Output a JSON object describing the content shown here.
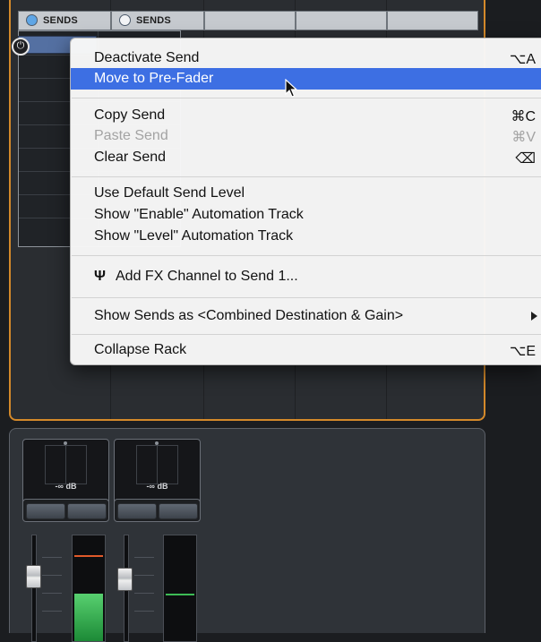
{
  "sends_headers": [
    {
      "label": "SENDS",
      "active": true
    },
    {
      "label": "SENDS",
      "active": false
    }
  ],
  "colors": {
    "rack_border": "#d4892a",
    "menu_highlight": "#3d6fe3",
    "send_active_slot": "#5470a2",
    "meter_green": "#2eaa4a",
    "meter_peak": "#e05a2a"
  },
  "context_menu": {
    "deactivate": {
      "label": "Deactivate Send",
      "shortcut": "⌥A"
    },
    "move_pre": {
      "label": "Move to Pre-Fader"
    },
    "copy": {
      "label": "Copy Send",
      "shortcut": "⌘C"
    },
    "paste": {
      "label": "Paste Send",
      "shortcut": "⌘V",
      "disabled": true
    },
    "clear": {
      "label": "Clear Send",
      "shortcut": "⌫"
    },
    "default_level": {
      "label": "Use Default Send Level"
    },
    "enable_auto": {
      "label": "Show \"Enable\" Automation Track"
    },
    "level_auto": {
      "label": "Show \"Level\" Automation Track"
    },
    "add_fx": {
      "label": "Add FX Channel to Send 1...",
      "icon": "fx-channel-icon"
    },
    "show_as": {
      "label": "Show Sends as <Combined Destination & Gain>",
      "has_submenu": true
    },
    "collapse": {
      "label": "Collapse Rack",
      "shortcut": "⌥E"
    }
  },
  "channels": [
    {
      "db": "-∞ dB",
      "fader_level": 0.62,
      "meter_level": 0.45
    },
    {
      "db": "-∞ dB",
      "fader_level": 0.58,
      "meter_level": 0.5
    }
  ]
}
